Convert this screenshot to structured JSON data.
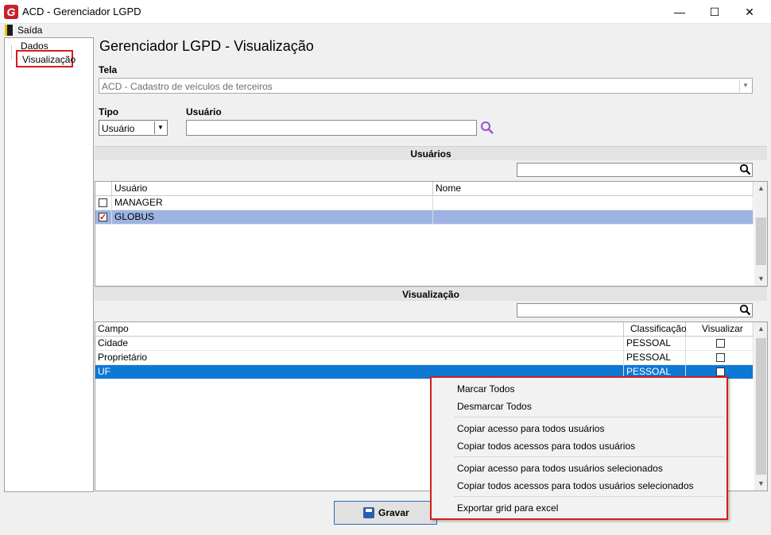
{
  "window": {
    "logo_letter": "G",
    "title": "ACD - Gerenciador LGPD",
    "minimize": "—",
    "maximize": "☐",
    "close": "✕"
  },
  "menu": {
    "exit_label": "Saída"
  },
  "tree": {
    "items": [
      "Dados",
      "Visualização"
    ],
    "selected": "Visualização"
  },
  "page": {
    "title": "Gerenciador LGPD - Visualização",
    "tela_label": "Tela",
    "tela_value": "ACD - Cadastro de veículos de terceiros",
    "tipo_label": "Tipo",
    "tipo_value": "Usuário",
    "usuario_label": "Usuário",
    "usuario_value": ""
  },
  "users_section": {
    "title": "Usuários",
    "search_value": "",
    "columns": [
      "Usuário",
      "Nome"
    ],
    "rows": [
      {
        "usuario": "MANAGER",
        "nome": "",
        "checked": false
      },
      {
        "usuario": "GLOBUS",
        "nome": "",
        "checked": true
      }
    ]
  },
  "vis_section": {
    "title": "Visualização",
    "search_value": "",
    "columns": [
      "Campo",
      "Classificação",
      "Visualizar"
    ],
    "rows": [
      {
        "campo": "Cidade",
        "classificacao": "PESSOAL",
        "visualizar": false
      },
      {
        "campo": "Proprietário",
        "classificacao": "PESSOAL",
        "visualizar": false
      },
      {
        "campo": "UF",
        "classificacao": "PESSOAL",
        "visualizar": false
      }
    ]
  },
  "save_button": {
    "label": "Gravar"
  },
  "context_menu": {
    "items": [
      "Marcar Todos",
      "Desmarcar Todos",
      "Copiar acesso para todos usuários",
      "Copiar todos acessos para todos usuários",
      "Copiar acesso para todos usuários selecionados",
      "Copiar todos acessos para todos usuários selecionados",
      "Exportar grid para excel"
    ]
  },
  "colors": {
    "highlight_red": "#d61c1c",
    "selection_blue": "#0e78d5",
    "row_select_light": "#9db4e3",
    "logo_red": "#c8202b",
    "search_purple": "#9b4fd6"
  }
}
